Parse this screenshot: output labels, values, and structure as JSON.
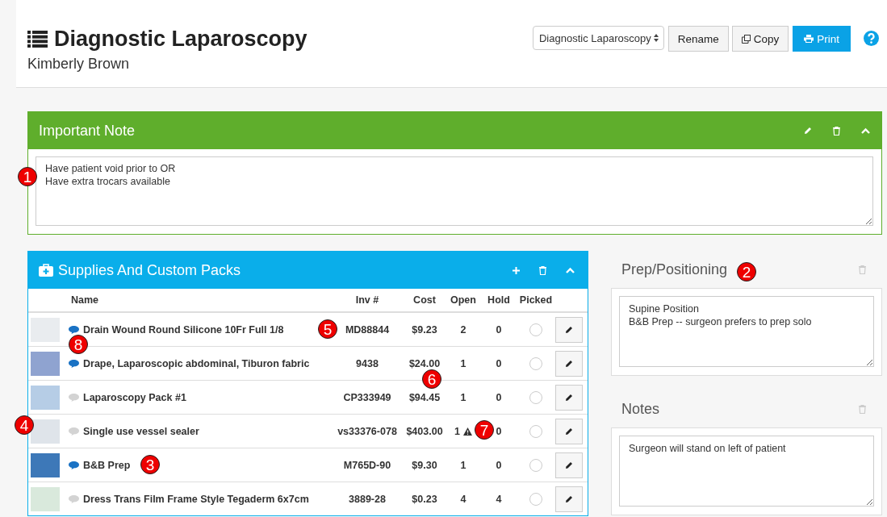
{
  "header": {
    "title": "Diagnostic Laparoscopy",
    "subtitle": "Kimberly Brown",
    "select_value": "Diagnostic Laparoscopy",
    "buttons": [
      {
        "label": "Rename",
        "kind": "plain"
      },
      {
        "label": "Copy",
        "kind": "copy"
      },
      {
        "label": "Print",
        "kind": "primary"
      }
    ]
  },
  "important_note": {
    "title": "Important Note",
    "text": "Have patient void prior to OR\nHave extra trocars available"
  },
  "supplies": {
    "title": "Supplies And Custom Packs",
    "columns": [
      "Name",
      "Inv #",
      "Cost",
      "Open",
      "Hold",
      "Picked"
    ],
    "rows": [
      {
        "name": "Drain Wound Round Silicone 10Fr Full 1/8",
        "inv": "MD88844",
        "cost": "$9.23",
        "open": "2",
        "hold": "0",
        "has_note": true,
        "warning": false,
        "picked": false
      },
      {
        "name": "Drape, Laparoscopic abdominal, Tiburon fabric",
        "inv": "9438",
        "cost": "$24.00",
        "open": "1",
        "hold": "0",
        "has_note": true,
        "warning": false,
        "picked": false
      },
      {
        "name": "Laparoscopy Pack #1",
        "inv": "CP333949",
        "cost": "$94.45",
        "open": "1",
        "hold": "0",
        "has_note": false,
        "warning": false,
        "picked": false
      },
      {
        "name": "Single use vessel sealer",
        "inv": "vs33376-078",
        "cost": "$403.00",
        "open": "1",
        "hold": "0",
        "has_note": false,
        "warning": true,
        "picked": false
      },
      {
        "name": "B&B Prep",
        "inv": "M765D-90",
        "cost": "$9.30",
        "open": "1",
        "hold": "0",
        "has_note": true,
        "warning": false,
        "picked": false
      },
      {
        "name": "Dress Trans Film Frame Style Tegaderm 6x7cm",
        "inv": "3889-28",
        "cost": "$0.23",
        "open": "4",
        "hold": "4",
        "has_note": false,
        "warning": false,
        "picked": false
      }
    ]
  },
  "side_notes": [
    {
      "title": "Prep/Positioning",
      "text": "Supine Position\nB&B Prep -- surgeon prefers to prep solo"
    },
    {
      "title": "Notes",
      "text": "Surgeon will stand on left of patient"
    }
  ],
  "callouts": [
    {
      "number": "1"
    },
    {
      "number": "2"
    },
    {
      "number": "3"
    },
    {
      "number": "4"
    },
    {
      "number": "5"
    },
    {
      "number": "6"
    },
    {
      "number": "7"
    },
    {
      "number": "8"
    }
  ]
}
